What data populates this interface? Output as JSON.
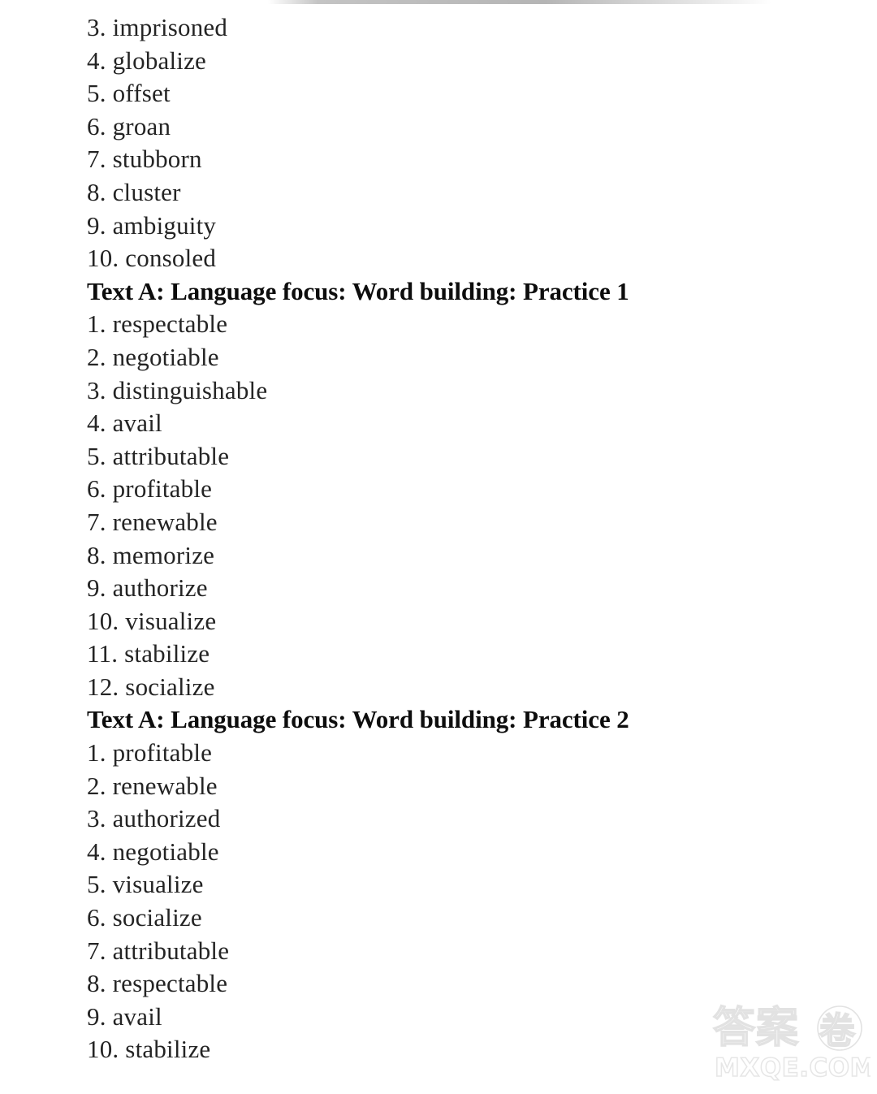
{
  "document": {
    "background_color": "#ffffff",
    "text_color": "#242424",
    "heading_color": "#0d0d0d",
    "blocks": [
      {
        "type": "answer-list",
        "items": [
          "3. imprisoned",
          "4. globalize",
          "5. offset",
          "6. groan",
          "7. stubborn",
          "8. cluster",
          "9. ambiguity",
          "10. consoled"
        ]
      },
      {
        "type": "heading",
        "text": "Text A: Language focus: Word building: Practice 1"
      },
      {
        "type": "answer-list",
        "items": [
          "1. respectable",
          "2. negotiable",
          "3. distinguishable",
          "4. avail",
          "5. attributable",
          "6. profitable",
          "7. renewable",
          "8. memorize",
          "9. authorize",
          "10. visualize",
          "11. stabilize",
          "12. socialize"
        ]
      },
      {
        "type": "heading",
        "text": "Text A: Language focus: Word building: Practice 2"
      },
      {
        "type": "answer-list",
        "items": [
          "1. profitable",
          "2. renewable",
          "3. authorized",
          "4. negotiable",
          "5. visualize",
          "6. socialize",
          "7. attributable",
          "8. respectable",
          "9. avail",
          "10. stabilize"
        ]
      }
    ]
  },
  "watermark": {
    "chinese_text": "答案",
    "badge_char": "卷",
    "domain_text": "MXQE.COM",
    "color": "#e4e4e4"
  }
}
